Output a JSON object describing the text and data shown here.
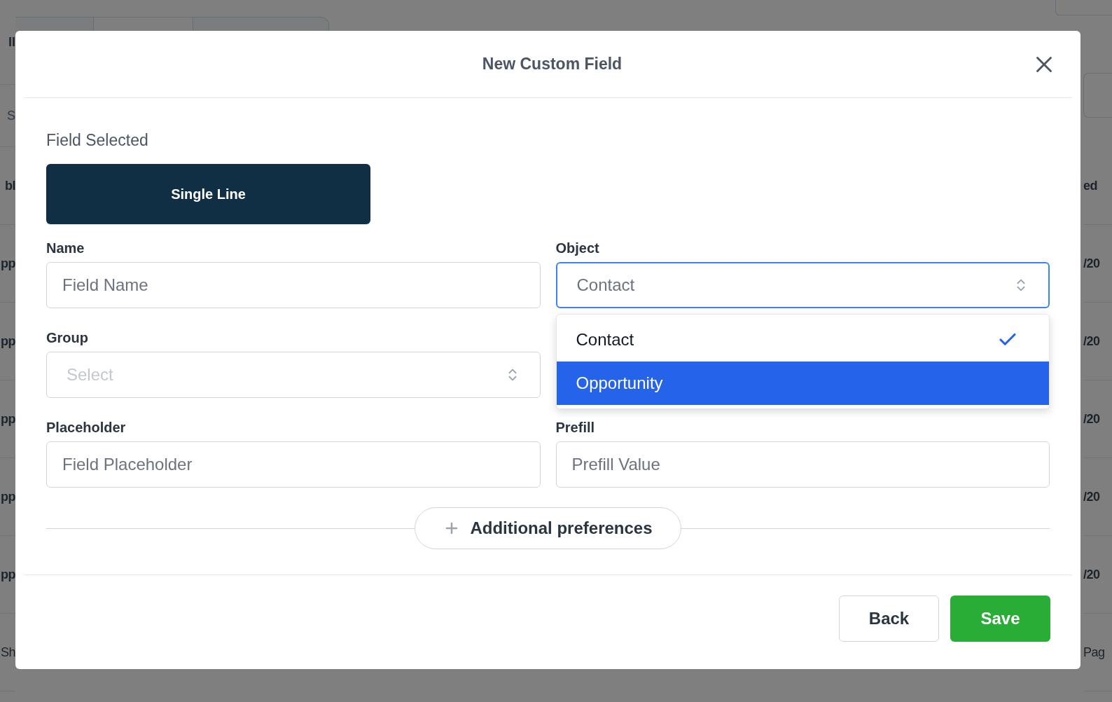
{
  "background": {
    "left_fragments": [
      {
        "kind": "tab",
        "text": "ll"
      },
      {
        "kind": "search",
        "text": "S"
      },
      {
        "kind": "heading",
        "text": "bl"
      },
      {
        "kind": "cell",
        "text": "pp"
      },
      {
        "kind": "cell",
        "text": "pp"
      },
      {
        "kind": "cell",
        "text": "pp"
      },
      {
        "kind": "cell",
        "text": "pp"
      },
      {
        "kind": "cell",
        "text": "pp"
      },
      {
        "kind": "footer",
        "text": "Sh"
      }
    ],
    "right_fragments": [
      {
        "kind": "heading",
        "text": "ed"
      },
      {
        "kind": "cell",
        "text": "/20"
      },
      {
        "kind": "cell",
        "text": "/20"
      },
      {
        "kind": "cell",
        "text": "/20"
      },
      {
        "kind": "cell",
        "text": "/20"
      },
      {
        "kind": "cell",
        "text": "/20"
      },
      {
        "kind": "footer",
        "text": "Pag"
      }
    ]
  },
  "dialog": {
    "title": "New Custom Field",
    "field_selected_label": "Field Selected",
    "field_type": "Single Line",
    "rows": [
      [
        {
          "label": "Name",
          "kind": "text",
          "placeholder": "Field Name"
        },
        {
          "label": "Object",
          "kind": "select",
          "value": "Contact",
          "open": true,
          "options": [
            {
              "label": "Contact",
              "selected": true,
              "highlighted": false
            },
            {
              "label": "Opportunity",
              "selected": false,
              "highlighted": true
            }
          ]
        }
      ],
      [
        {
          "label": "Group",
          "kind": "select",
          "placeholder": "Select",
          "open": false
        }
      ],
      [
        {
          "label": "Placeholder",
          "kind": "text",
          "placeholder": "Field Placeholder"
        },
        {
          "label": "Prefill",
          "kind": "text",
          "placeholder": "Prefill Value"
        }
      ]
    ],
    "additional_button": "Additional preferences",
    "buttons": [
      {
        "label": "Back",
        "kind": "secondary"
      },
      {
        "label": "Save",
        "kind": "primary"
      }
    ]
  }
}
